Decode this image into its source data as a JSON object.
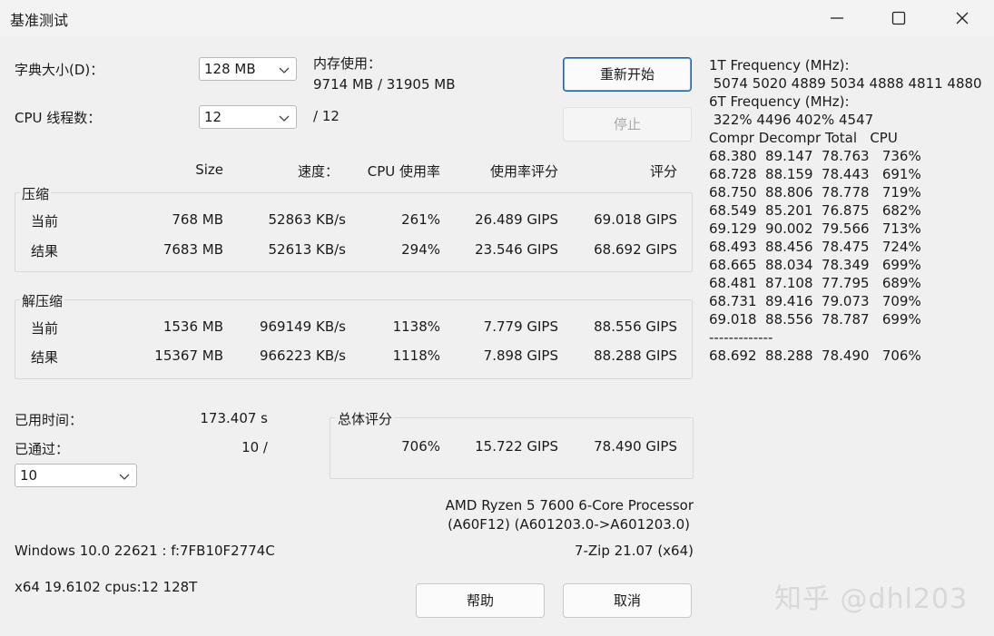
{
  "window": {
    "title": "基准测试",
    "minimize_icon": "minimize-icon",
    "maximize_icon": "maximize-icon",
    "close_icon": "close-icon"
  },
  "settings": {
    "dict_label": "字典大小(D)：",
    "dict_value": "128 MB",
    "threads_label": "CPU 线程数：",
    "threads_value": "12",
    "threads_max": "/ 12",
    "memory_label": "内存使用：",
    "memory_value": "9714 MB / 31905 MB"
  },
  "buttons": {
    "restart": "重新开始",
    "stop": "停止",
    "help": "帮助",
    "cancel": "取消"
  },
  "table": {
    "headers": [
      "Size",
      "速度：",
      "CPU 使用率",
      "使用率评分",
      "评分"
    ],
    "compress_label": "压缩",
    "compress_rows": [
      {
        "label": "当前",
        "size": "768 MB",
        "speed": "52863 KB/s",
        "cpu": "261%",
        "rating_usage": "26.489 GIPS",
        "rating": "69.018 GIPS"
      },
      {
        "label": "结果",
        "size": "7683 MB",
        "speed": "52613 KB/s",
        "cpu": "294%",
        "rating_usage": "23.546 GIPS",
        "rating": "68.692 GIPS"
      }
    ],
    "decompress_label": "解压缩",
    "decompress_rows": [
      {
        "label": "当前",
        "size": "1536 MB",
        "speed": "969149 KB/s",
        "cpu": "1138%",
        "rating_usage": "7.779 GIPS",
        "rating": "88.556 GIPS"
      },
      {
        "label": "结果",
        "size": "15367 MB",
        "speed": "966223 KB/s",
        "cpu": "1118%",
        "rating_usage": "7.898 GIPS",
        "rating": "88.288 GIPS"
      }
    ]
  },
  "status": {
    "elapsed_label": "已用时间：",
    "elapsed_value": "173.407 s",
    "passes_label": "已通过：",
    "passes_value": "10 /",
    "passes_select": "10"
  },
  "total": {
    "label": "总体评分",
    "cpu": "706%",
    "rating_usage": "15.722 GIPS",
    "rating": "78.490 GIPS"
  },
  "system": {
    "cpu_name": "AMD Ryzen 5 7600 6-Core Processor",
    "cpu_id": "(A60F12) (A601203.0->A601203.0)",
    "os": "Windows 10.0 22621 : f:7FB10F2774C",
    "version": "7-Zip 21.07 (x64)",
    "arch": "x64 19.6102 cpus:12 128T"
  },
  "log": {
    "freq1_label": "1T Frequency (MHz):",
    "freq1_values": " 5074 5020 4889 5034 4888 4811 4880",
    "freq6_label": "6T Frequency (MHz):",
    "freq6_values": " 322% 4496 402% 4547",
    "header": "Compr Decompr Total   CPU",
    "rows": [
      "68.380  89.147  78.763   736%",
      "68.728  88.159  78.443   691%",
      "68.750  88.806  78.778   719%",
      "68.549  85.201  76.875   682%",
      "69.129  90.002  79.566   713%",
      "68.493  88.456  78.475   724%",
      "68.665  88.034  78.349   699%",
      "68.481  87.108  77.795   689%",
      "68.731  89.416  79.073   709%",
      "69.018  88.556  78.787   699%"
    ],
    "separator": "-------------",
    "summary": "68.692  88.288  78.490   706%"
  },
  "watermark": "知乎 @dhl203",
  "colors": {
    "background": "#f0f0f0",
    "accent_border": "#1e5f9f",
    "disabled_text": "#a8a8a8"
  }
}
